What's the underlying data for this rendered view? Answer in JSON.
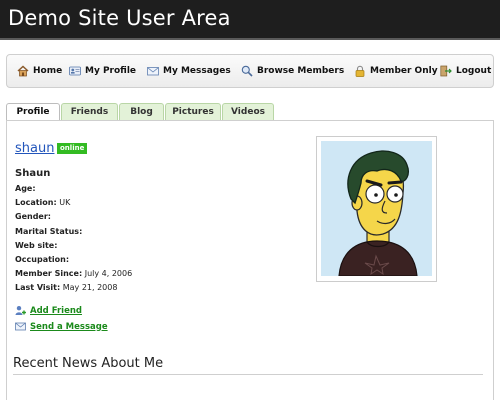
{
  "header": {
    "title": "Demo Site User Area"
  },
  "nav": {
    "items": [
      {
        "label": "Home",
        "icon": "home-icon"
      },
      {
        "label": "My Profile",
        "icon": "profile-card-icon"
      },
      {
        "label": "My Messages",
        "icon": "envelope-icon"
      },
      {
        "label": "Browse Members",
        "icon": "magnifier-icon"
      },
      {
        "label": "Member Only",
        "icon": "lock-icon"
      },
      {
        "label": "Logout",
        "icon": "logout-icon"
      }
    ]
  },
  "tabs": [
    {
      "label": "Profile",
      "active": true
    },
    {
      "label": "Friends",
      "active": false
    },
    {
      "label": "Blog",
      "active": false
    },
    {
      "label": "Pictures",
      "active": false
    },
    {
      "label": "Videos",
      "active": false
    }
  ],
  "profile": {
    "username": "shaun",
    "status": "online",
    "display_name": "Shaun",
    "fields": [
      {
        "label": "Age:",
        "value": ""
      },
      {
        "label": "Location:",
        "value": "UK"
      },
      {
        "label": "Gender:",
        "value": ""
      },
      {
        "label": "Marital Status:",
        "value": ""
      },
      {
        "label": "Web site:",
        "value": ""
      },
      {
        "label": "Occupation:",
        "value": ""
      },
      {
        "label": "Member Since:",
        "value": "July 4, 2006"
      },
      {
        "label": "Last Visit:",
        "value": "May 21, 2008"
      }
    ]
  },
  "actions": {
    "add_friend": "Add Friend",
    "send_message": "Send a Message"
  },
  "news": {
    "title": "Recent News About Me"
  },
  "colors": {
    "header_bg": "#1e1e1e",
    "link_blue": "#2255bb",
    "action_green": "#1b8a1b",
    "online_badge": "#33bb22",
    "tab_green": "#e3f2d8"
  }
}
